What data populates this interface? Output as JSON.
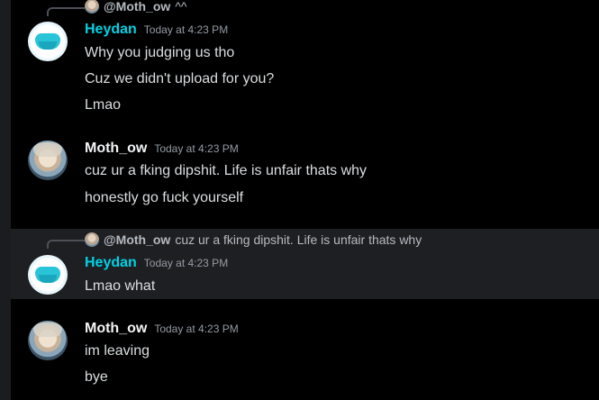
{
  "colors": {
    "background": "#000000",
    "highlight_row": "#1e1f22",
    "heydan_name": "#00d2e6",
    "text": "#dbdee1",
    "muted": "#949ba4"
  },
  "messages": [
    {
      "reply": {
        "author": "@Moth_ow",
        "text": "^^"
      },
      "author": "Heydan",
      "timestamp": "Today at 4:23 PM",
      "lines": [
        "Why you judging us tho",
        "Cuz we didn't upload for you?",
        "Lmao"
      ]
    },
    {
      "author": "Moth_ow",
      "timestamp": "Today at 4:23 PM",
      "lines": [
        "cuz ur a fking dipshit. Life is unfair thats why",
        "honestly go fuck yourself"
      ]
    },
    {
      "reply": {
        "author": "@Moth_ow",
        "text": "cuz ur a fking dipshit. Life is unfair thats why"
      },
      "author": "Heydan",
      "timestamp": "Today at 4:23 PM",
      "lines": [
        "Lmao what"
      ]
    },
    {
      "author": "Moth_ow",
      "timestamp": "Today at 4:23 PM",
      "lines": [
        "im leaving",
        "bye"
      ]
    }
  ]
}
